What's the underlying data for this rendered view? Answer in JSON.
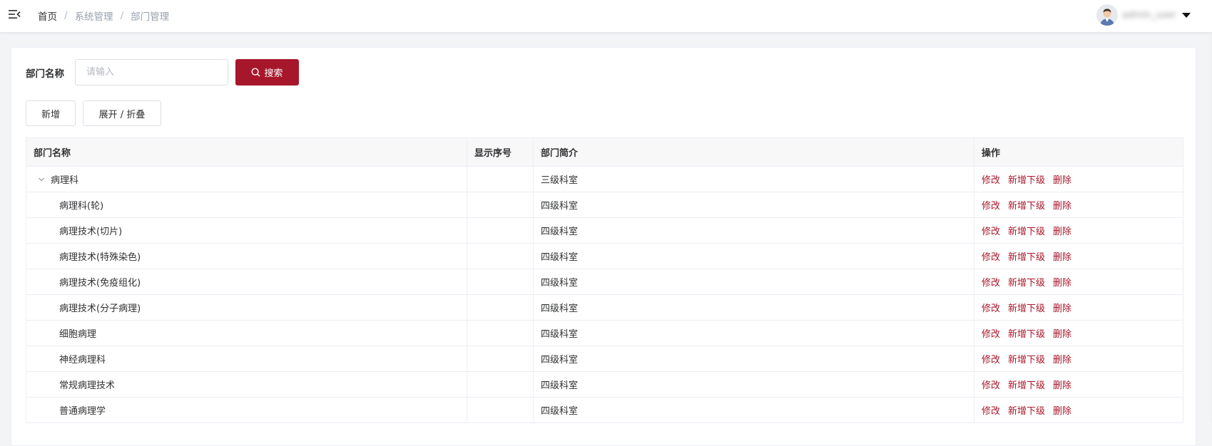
{
  "breadcrumb": {
    "home": "首页",
    "sep": "/",
    "system": "系统管理",
    "current": "部门管理"
  },
  "user": {
    "name": "admin_user"
  },
  "search": {
    "label": "部门名称",
    "placeholder": "请输入",
    "value": "",
    "button": "搜索"
  },
  "toolbar": {
    "add": "新增",
    "expand_collapse": "展开 / 折叠"
  },
  "colors": {
    "primary": "#a7172b",
    "link": "#a7172b"
  },
  "table": {
    "columns": [
      "部门名称",
      "显示序号",
      "部门简介",
      "操作"
    ],
    "ops": [
      "修改",
      "新增下级",
      "删除"
    ],
    "rows": [
      {
        "name": "病理科",
        "order": "",
        "desc": "三级科室",
        "level": 0,
        "expanded": true
      },
      {
        "name": "病理科(轮)",
        "order": "",
        "desc": "四级科室",
        "level": 1
      },
      {
        "name": "病理技术(切片)",
        "order": "",
        "desc": "四级科室",
        "level": 1
      },
      {
        "name": "病理技术(特殊染色)",
        "order": "",
        "desc": "四级科室",
        "level": 1
      },
      {
        "name": "病理技术(免疫组化)",
        "order": "",
        "desc": "四级科室",
        "level": 1
      },
      {
        "name": "病理技术(分子病理)",
        "order": "",
        "desc": "四级科室",
        "level": 1
      },
      {
        "name": "细胞病理",
        "order": "",
        "desc": "四级科室",
        "level": 1
      },
      {
        "name": "神经病理科",
        "order": "",
        "desc": "四级科室",
        "level": 1
      },
      {
        "name": "常规病理技术",
        "order": "",
        "desc": "四级科室",
        "level": 1
      },
      {
        "name": "普通病理学",
        "order": "",
        "desc": "四级科室",
        "level": 1
      }
    ]
  }
}
